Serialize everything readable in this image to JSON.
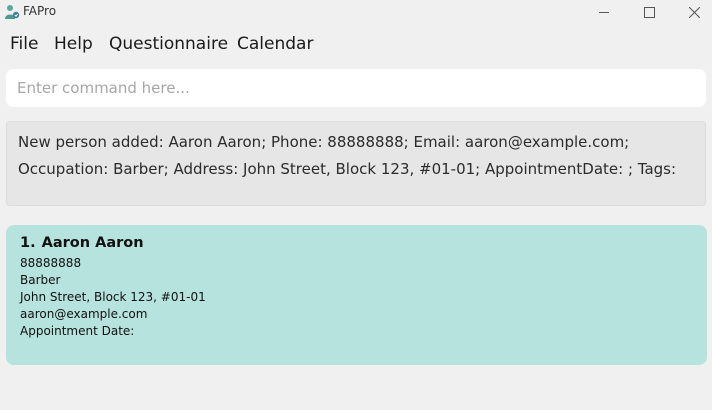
{
  "window": {
    "title": "FAPro",
    "app_icon": "person-icon",
    "controls": [
      "minimize-icon",
      "maximize-icon",
      "close-icon"
    ]
  },
  "menu": {
    "items": [
      "File",
      "Help",
      "Questionnaire",
      "Calendar"
    ]
  },
  "command": {
    "placeholder": "Enter command here...",
    "value": ""
  },
  "result": {
    "lines": [
      "New person added: Aaron Aaron; Phone: 88888888; Email: aaron@example.com;",
      "Occupation: Barber; Address: John Street, Block 123, #01-01; AppointmentDate: ; Tags:"
    ]
  },
  "persons": [
    {
      "index": "1.",
      "name": "Aaron Aaron",
      "phone": "88888888",
      "occupation": "Barber",
      "address": "John Street, Block 123, #01-01",
      "email": "aaron@example.com",
      "appointment_label": "Appointment Date:",
      "appointment_value": ""
    }
  ],
  "colors": {
    "background": "#f0f0f0",
    "card": "#b6e3dd",
    "result_box": "#e6e6e6",
    "icon_accent": "#4d9a8f"
  }
}
